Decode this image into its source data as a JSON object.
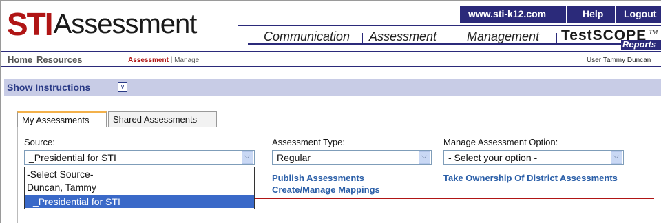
{
  "header": {
    "logo_sti": "STI",
    "logo_assessment": "Assessment",
    "top_links": [
      "www.sti-k12.com",
      "Help",
      "Logout"
    ],
    "nav": [
      "Communication",
      "Assessment",
      "Management"
    ],
    "testscope": "TestSCOPE",
    "tm": "TM",
    "reports": "Reports"
  },
  "subnav": {
    "home": "Home",
    "resources": "Resources",
    "breadcrumb_current": "Assessment",
    "breadcrumb_sep": "|",
    "breadcrumb_next": "Manage",
    "user": "User:Tammy Duncan"
  },
  "instructions": {
    "label": "Show Instructions",
    "icon": "chevron-double-down-icon"
  },
  "tabs": [
    {
      "label": "My Assessments",
      "active": true
    },
    {
      "label": "Shared Assessments",
      "active": false
    }
  ],
  "form": {
    "source": {
      "label": "Source:",
      "value": "_Presidential for STI",
      "options": [
        "-Select Source-",
        "Duncan, Tammy",
        "_Presidential for STI"
      ],
      "selected_index": 2
    },
    "assessment_type": {
      "label": "Assessment Type:",
      "value": "Regular"
    },
    "manage_option": {
      "label": "Manage Assessment Option:",
      "value": "- Select your option -"
    }
  },
  "links": {
    "publish": "Publish Assessments",
    "mappings": "Create/Manage Mappings",
    "ownership": "Take Ownership Of District Assessments"
  },
  "colors": {
    "brand_red": "#b01515",
    "navy": "#2b2a7a",
    "instr_bar": "#c8cce6",
    "link_blue": "#2b5fa8",
    "selected_blue": "#3a69c8",
    "tab_accent": "#f3b14b"
  }
}
